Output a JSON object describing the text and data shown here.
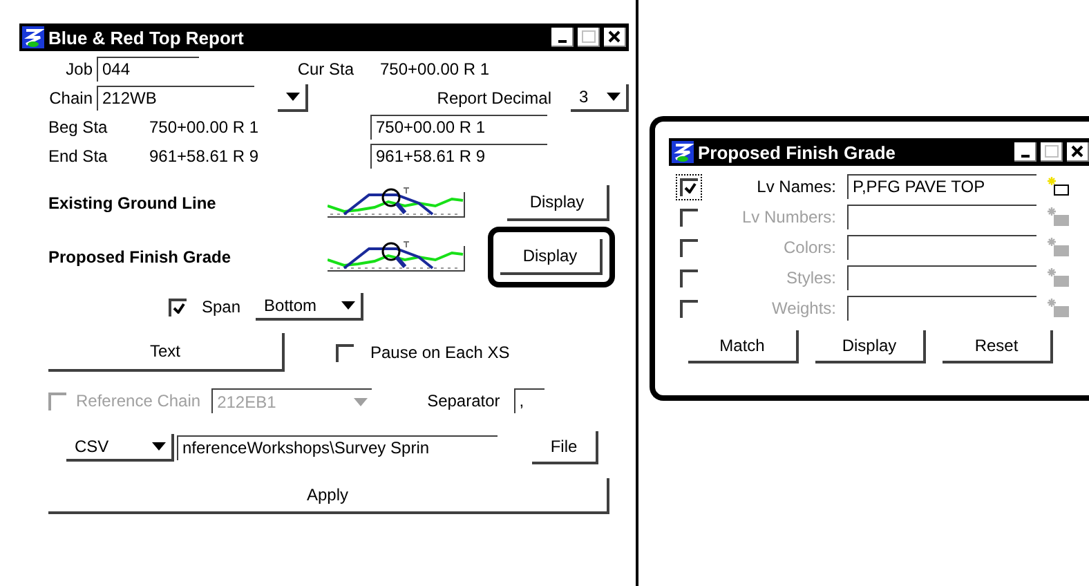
{
  "report_window": {
    "title": "Blue & Red Top Report",
    "job": {
      "label": "Job",
      "value": "044"
    },
    "cur_sta": {
      "label": "Cur Sta",
      "value": "750+00.00 R 1"
    },
    "chain": {
      "label": "Chain",
      "value": "212WB"
    },
    "report_decimal": {
      "label": "Report Decimal",
      "value": "3"
    },
    "stations": [
      {
        "label": "Beg Sta",
        "value": "750+00.00 R 1",
        "field": "750+00.00 R 1"
      },
      {
        "label": "End Sta",
        "value": "961+58.61 R 9",
        "field": "961+58.61 R 9"
      }
    ],
    "sections": [
      {
        "label": "Existing Ground Line",
        "button": "Display",
        "highlighted": false
      },
      {
        "label": "Proposed Finish Grade",
        "button": "Display",
        "highlighted": true
      }
    ],
    "span": {
      "label": "Span",
      "checked": true,
      "value": "Bottom"
    },
    "text_button": "Text",
    "pause": {
      "label": "Pause on Each XS",
      "checked": false
    },
    "reference_chain": {
      "label": "Reference Chain",
      "checked": false,
      "disabled": true,
      "value": "212EB1"
    },
    "separator": {
      "label": "Separator",
      "value": ","
    },
    "format": {
      "value": "CSV"
    },
    "path": {
      "value": "nferenceWorkshops\\Survey Sprin"
    },
    "file_button": "File",
    "apply_button": "Apply"
  },
  "grade_window": {
    "title": "Proposed Finish Grade",
    "highlighted": true,
    "rows": [
      {
        "label": "Lv Names:",
        "checked": true,
        "disabled": false,
        "value": "P,PFG PAVE TOP"
      },
      {
        "label": "Lv Numbers:",
        "checked": false,
        "disabled": true
      },
      {
        "label": "Colors:",
        "checked": false,
        "disabled": true
      },
      {
        "label": "Styles:",
        "checked": false,
        "disabled": true
      },
      {
        "label": "Weights:",
        "checked": false,
        "disabled": true
      }
    ],
    "buttons": [
      "Match",
      "Display",
      "Reset"
    ]
  }
}
